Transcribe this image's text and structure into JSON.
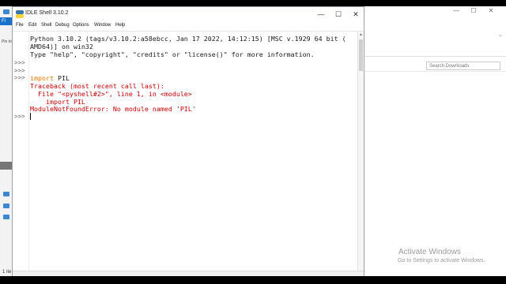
{
  "idle_window": {
    "title": "IDLE Shell 3.10.2",
    "controls": {
      "minimize": "—",
      "maximize": "☐",
      "close": "✕"
    },
    "menu": [
      "File",
      "Edit",
      "Shell",
      "Debug",
      "Options",
      "Window",
      "Help"
    ],
    "shell_prompt": ">>>",
    "banner": {
      "line1": "Python 3.10.2 (tags/v3.10.2:a58ebcc, Jan 17 2022, 14:12:15) [MSC v.1929 64 bit (",
      "line2": "AMD64)] on win32",
      "line3": "Type \"help\", \"copyright\", \"credits\" or \"license()\" for more information."
    },
    "session": {
      "import_keyword": "import",
      "import_module": " PIL",
      "traceback_header": "Traceback (most recent call last):",
      "traceback_file": "  File \"<pyshell#2>\", line 1, in <module>",
      "traceback_code": "    import PIL",
      "error": "ModuleNotFoundError: No module named 'PIL'"
    }
  },
  "background_explorer": {
    "search_placeholder": "Search Downloads",
    "controls": {
      "minimize": "—",
      "maximize": "☐",
      "close": "✕"
    },
    "left_tab_label": "Fi",
    "left_small_text": "Pin to",
    "status_left": "1 ite"
  },
  "watermark": {
    "title": "Activate Windows",
    "subtitle": "Go to Settings to activate Windows."
  },
  "colors": {
    "keyword": "#e67300",
    "error": "#c00000",
    "accent_blue": "#1a73c8"
  }
}
